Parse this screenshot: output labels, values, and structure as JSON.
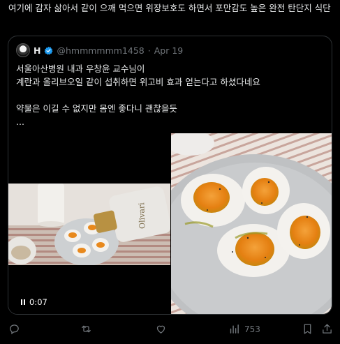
{
  "post": {
    "text": "여기에 감자 삶아서 같이 으깨 먹으면 위장보호도 하면서 포만감도 높은 완전 탄단지 식단"
  },
  "quote": {
    "display_name": "H",
    "handle": "@hmmmmmm1458",
    "separator": "·",
    "date": "Apr 19",
    "body": "서울아산병원 내과 우창윤 교수님이\n계란과 올리브오일 같이 섭취하면 위고비 효과 얻는다고 하셨다네요\n\n약물은 이길 수 없지만 몸엔 좋다니 괜찮을듯\n...",
    "video": {
      "duration": "0:07"
    },
    "bottle_label": "Olivari"
  },
  "actions": {
    "reply_count": "",
    "repost_count": "",
    "like_count": "",
    "views_count": "753"
  },
  "icons": [
    "verified-badge-icon",
    "pause-icon",
    "reply-icon",
    "repost-icon",
    "like-icon",
    "views-icon",
    "bookmark-icon",
    "share-icon"
  ],
  "colors": {
    "background": "#000000",
    "text": "#e7e9ea",
    "muted": "#71767b",
    "border": "#2f3336",
    "verified": "#1d9bf0"
  }
}
